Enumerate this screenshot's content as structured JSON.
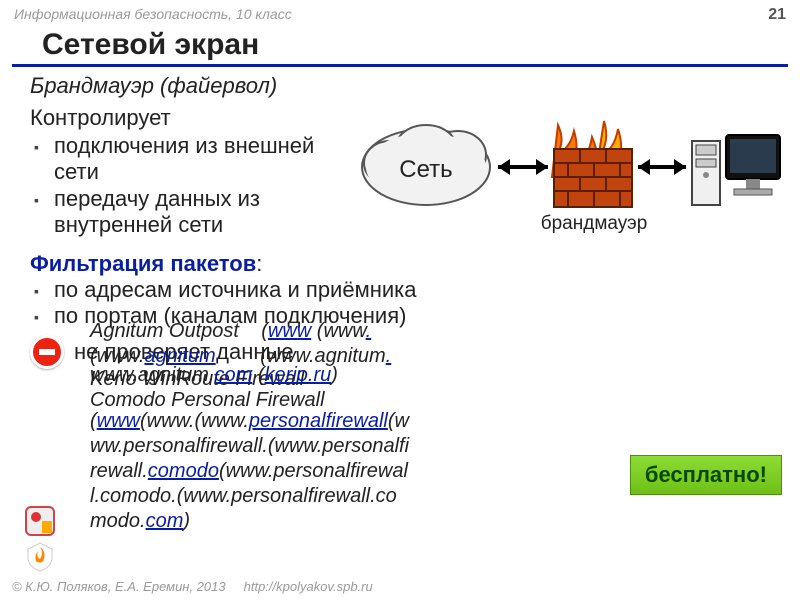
{
  "topbar": {
    "label": "Информационная безопасность, 10 класс",
    "page": "21"
  },
  "title": "Сетевой экран",
  "subtitle": "Брандмауэр (файервол)",
  "controls": {
    "head": "Контролирует",
    "items": [
      "подключения из внешней сети",
      "передачу данных из внутренней сети"
    ]
  },
  "diagram": {
    "cloud_label": "Сеть",
    "wall_label": "брандмауэр"
  },
  "filter": {
    "head": "Фильтрация пакетов",
    "items": [
      "по адресам источника и приёмника",
      "по портам (каналам подключения)"
    ]
  },
  "nocheck": "не проверяет данные",
  "software": {
    "line1_a": "Agnitum Outpost",
    "line1_b": "(",
    "line1_link1": "www",
    "line1_c": " (www",
    "line1_link2": ".",
    "line2_a": "(www.",
    "line2_link": "agnitum",
    "line2_b": " (www.agnitum",
    "line2_link2": ".",
    "line3_a": "Kerio WinRoute Firewall",
    "line3_b": "www.agnitum.",
    "line3_link": "com",
    "line3_c": " (",
    "line3_link2": "kerio.ru",
    "line3_d": ")",
    "line4_name": "Comodo Personal Firewall",
    "line5_a": "(",
    "line5_link1": "www",
    "line5_b": "(www.(www.",
    "line5_link2": "personalfirewall",
    "line5_c": "(w",
    "line6": "ww.personalfirewall.(www.personalfi",
    "line7_a": "rewall.",
    "line7_link": "comodo",
    "line7_b": "(www.personalfirewal",
    "line8": "l.comodo.(www.personalfirewall.co",
    "line9_a": "modo.",
    "line9_link": "com",
    "line9_b": ")"
  },
  "free_badge": "бесплатно!",
  "footer": {
    "copyright": "© К.Ю. Поляков, Е.А. Еремин, 2013",
    "url": "http://kpolyakov.spb.ru"
  }
}
